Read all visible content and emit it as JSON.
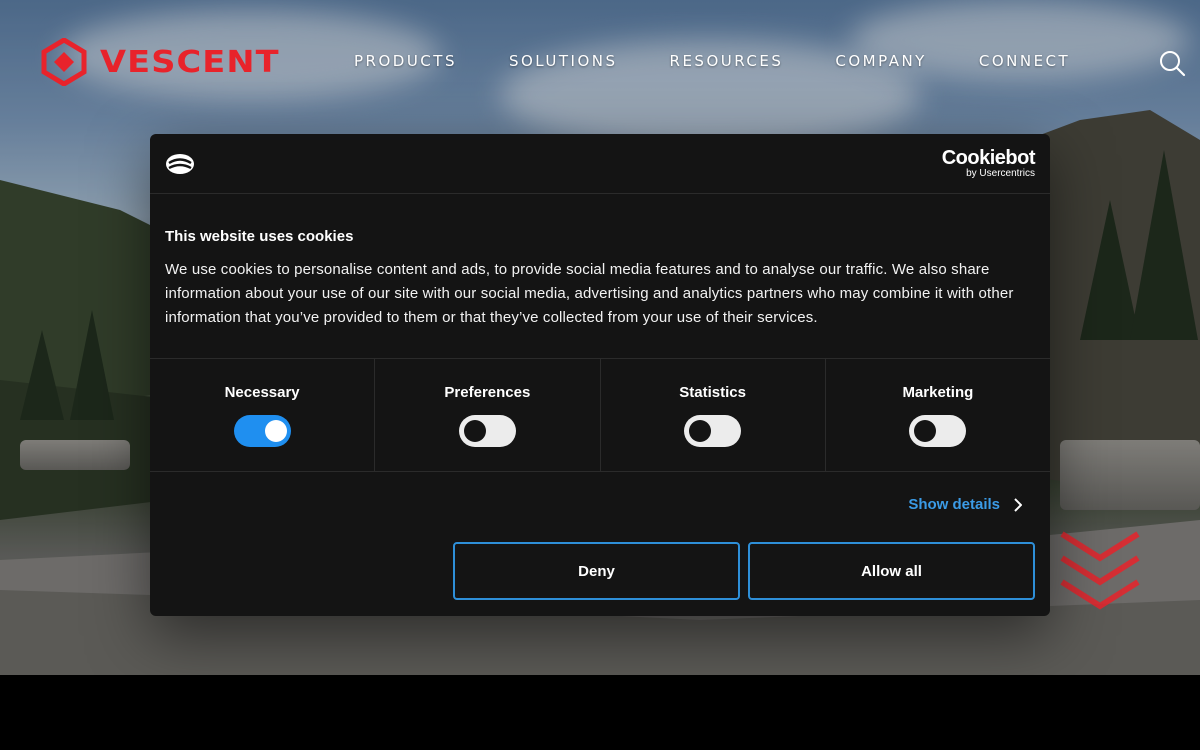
{
  "header": {
    "brand": "VESCENT",
    "nav": [
      "PRODUCTS",
      "SOLUTIONS",
      "RESOURCES",
      "COMPANY",
      "CONNECT"
    ],
    "search_icon": "search-icon",
    "brand_color": "#e8232b"
  },
  "cookie_banner": {
    "provider_name": "Cookiebot",
    "provider_sub": "by Usercentrics",
    "title": "This website uses cookies",
    "text": "We use cookies to personalise content and ads, to provide social media features and to analyse our traffic. We also share information about your use of our site with our social media, advertising and analytics partners who may combine it with other information that you’ve provided to them or that they’ve collected from your use of their services.",
    "categories": [
      {
        "label": "Necessary",
        "enabled": true
      },
      {
        "label": "Preferences",
        "enabled": false
      },
      {
        "label": "Statistics",
        "enabled": false
      },
      {
        "label": "Marketing",
        "enabled": false
      }
    ],
    "show_details_label": "Show details",
    "deny_label": "Deny",
    "allow_all_label": "Allow all",
    "accent_color": "#1f8ff0"
  },
  "scroll_indicator": {
    "icon": "chevron-down-icon"
  }
}
